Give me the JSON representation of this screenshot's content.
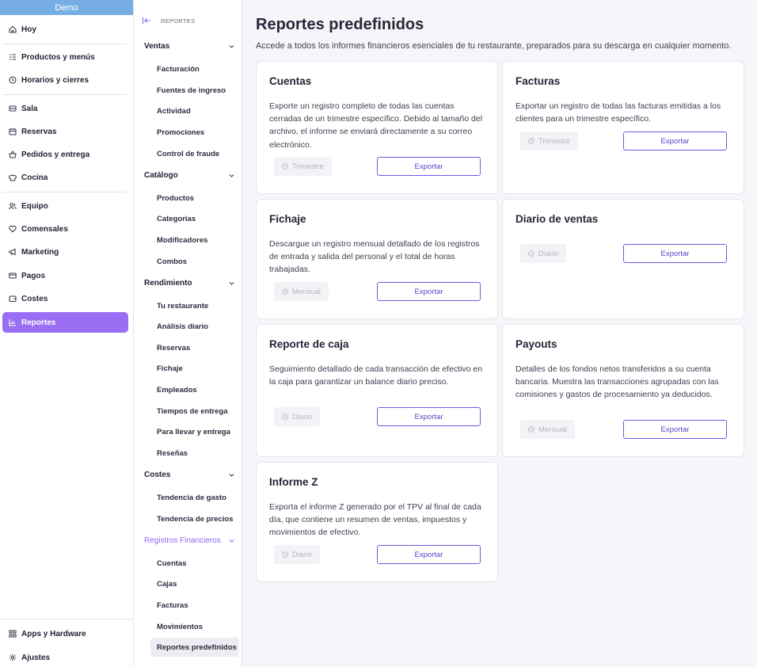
{
  "sidebar": {
    "brand": "Demo",
    "items": [
      {
        "label": "Hoy",
        "icon": "home-icon"
      },
      {
        "label": "Productos y menús",
        "icon": "list-icon"
      },
      {
        "label": "Horarios y cierres",
        "icon": "clock-icon"
      },
      {
        "label": "Sala",
        "icon": "sofa-icon"
      },
      {
        "label": "Reservas",
        "icon": "calendar-icon"
      },
      {
        "label": "Pedidos y entrega",
        "icon": "basket-icon"
      },
      {
        "label": "Cocina",
        "icon": "chef-hat-icon"
      },
      {
        "label": "Equipo",
        "icon": "users-icon"
      },
      {
        "label": "Comensales",
        "icon": "heart-icon"
      },
      {
        "label": "Marketing",
        "icon": "megaphone-icon"
      },
      {
        "label": "Pagos",
        "icon": "credit-card-icon"
      },
      {
        "label": "Costes",
        "icon": "wallet-icon"
      },
      {
        "label": "Reportes",
        "icon": "chart-icon"
      }
    ],
    "bottom": [
      {
        "label": "Apps y Hardware",
        "icon": "apps-icon"
      },
      {
        "label": "Ajustes",
        "icon": "gear-icon"
      }
    ],
    "active": "Reportes"
  },
  "subnav": {
    "header": "REPORTES",
    "groups": [
      {
        "label": "Ventas",
        "items": [
          "Facturación",
          "Fuentes de ingreso",
          "Actividad",
          "Promociones",
          "Control de fraude"
        ]
      },
      {
        "label": "Catálogo",
        "items": [
          "Productos",
          "Categorias",
          "Modificadores",
          "Combos"
        ]
      },
      {
        "label": "Rendimiento",
        "items": [
          "Tu restaurante",
          "Análisis diario",
          "Reservas",
          "Fichaje",
          "Empleados",
          "Tiempos de entrega",
          "Para llevar y entrega",
          "Reseñas"
        ]
      },
      {
        "label": "Costes",
        "items": [
          "Tendencia de gasto",
          "Tendencia de precios"
        ]
      },
      {
        "label": "Registros Financieros",
        "items": [
          "Cuentas",
          "Cajas",
          "Facturas",
          "Movimientos",
          "Reportes predefinidos"
        ]
      }
    ],
    "active": "Reportes predefinidos"
  },
  "main": {
    "title": "Reportes predefinidos",
    "subtitle": "Accede a todos los informes financieros esenciales de tu restaurante, preparados para su descarga en cualquier momento.",
    "export_label": "Exportar",
    "cards": [
      {
        "title": "Cuentas",
        "description": "Exporte un registro completo de todas las cuentas cerradas de un trimestre específico. Debido al tamaño del archivo, el informe se enviará directamente a su correo electrónico.",
        "period": "Trimestre"
      },
      {
        "title": "Facturas",
        "description": "Exportar un registro de todas las facturas emitidas a los clientes para un trimestre específico.",
        "period": "Trimestre"
      },
      {
        "title": "Fichaje",
        "description": "Descargue un registro mensual detallado de los registros de entrada y salida del personal y el total de horas trabajadas.",
        "period": "Mensual"
      },
      {
        "title": "Diario de ventas",
        "description": "",
        "period": "Diario"
      },
      {
        "title": "Reporte de caja",
        "description": "Seguimiento detallado de cada transacción de efectivo en la caja para garantizar un balance diario preciso.",
        "period": "Diario"
      },
      {
        "title": "Payouts",
        "description": "Detalles de los fondos netos transferidos a su cuenta bancaria. Muestra las transacciones agrupadas con las comisiones y gastos de procesamiento ya deducidos.",
        "period": "Mensual"
      },
      {
        "title": "Informe Z",
        "description": "Exporta el informe Z generado por el TPV al final de cada día, que contiene un resumen de ventas, impuestos y movimientos de efectivo.",
        "period": "Diario"
      }
    ]
  },
  "colors": {
    "accent": "#9a6ff3",
    "brand_bar": "#76aee4",
    "button_border": "#7b52e8"
  }
}
